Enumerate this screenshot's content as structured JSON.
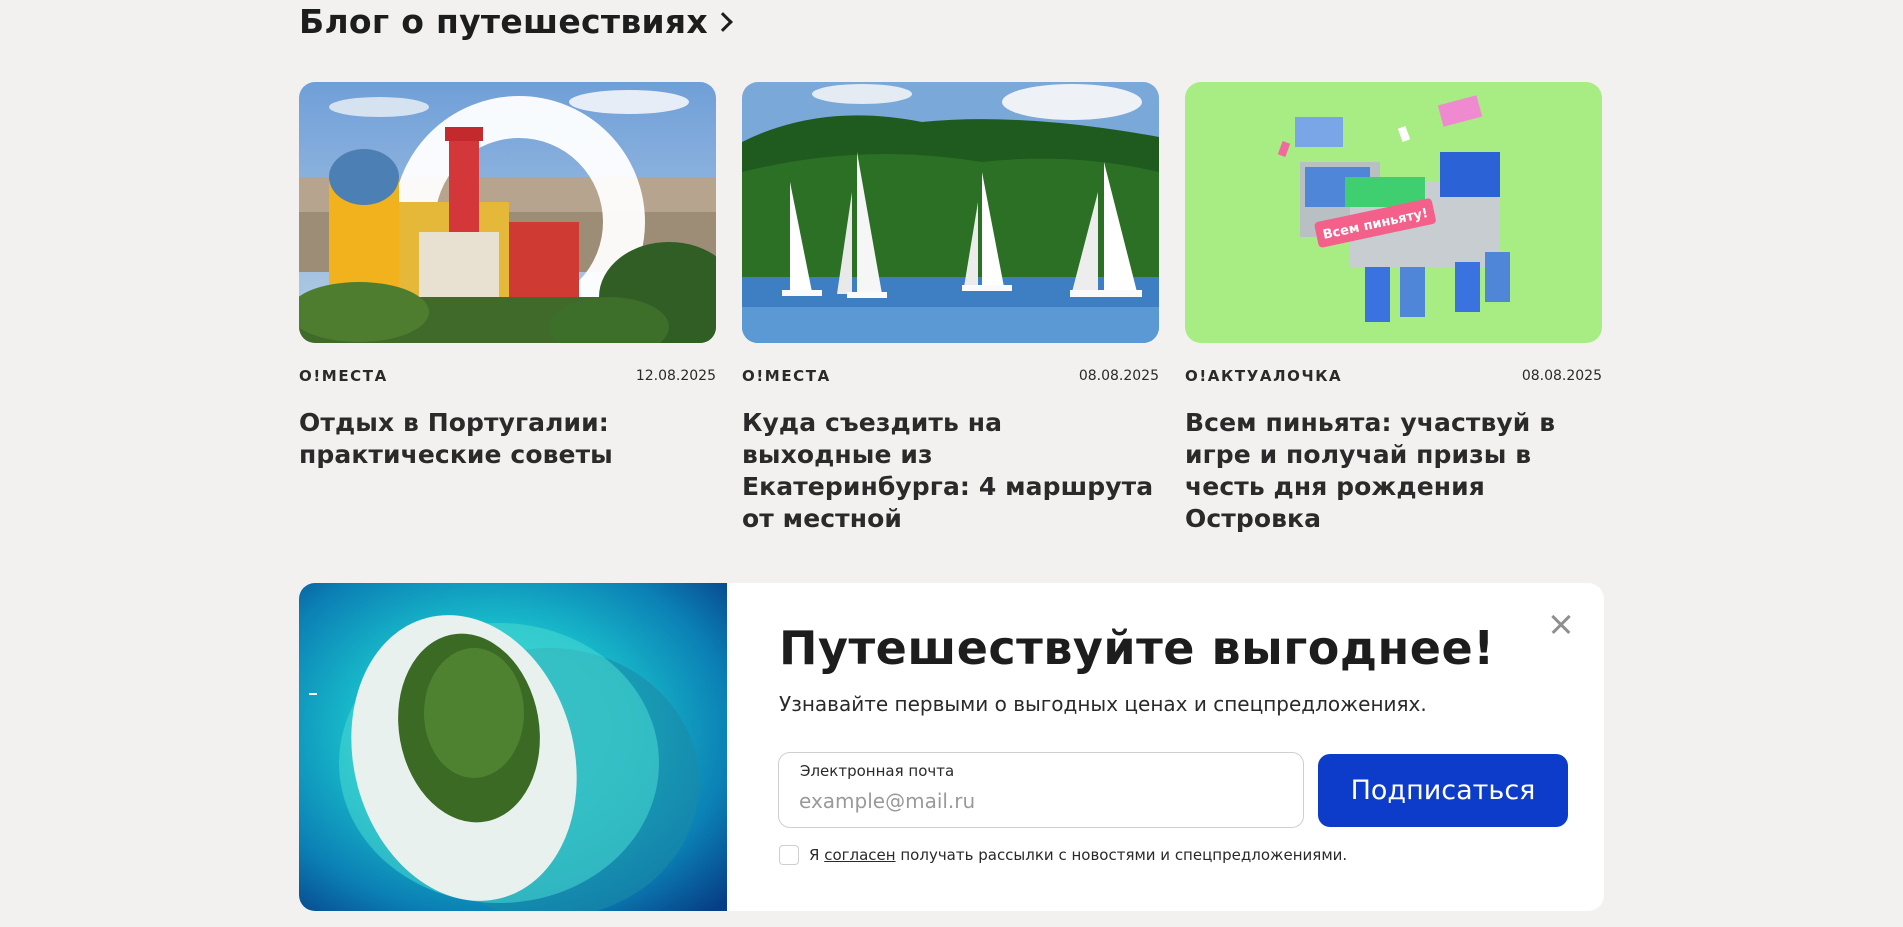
{
  "blog": {
    "title": "Блог о путешествиях",
    "cards": [
      {
        "category": "O!МЕСТА",
        "date": "12.08.2025",
        "title": "Отдых в Португалии: практические советы",
        "image": "pena-palace-portugal"
      },
      {
        "category": "O!МЕСТА",
        "date": "08.08.2025",
        "title": "Куда съездить на выходные из Екатеринбурга: 4 маршрута от местной",
        "image": "sailboats-on-lake"
      },
      {
        "category": "O!АКТУАЛОЧКА",
        "date": "08.08.2025",
        "title": "Всем пиньята: участвуй в игре и получай призы в честь дня рождения Островка",
        "image": "pinata-on-green"
      }
    ]
  },
  "promo": {
    "title": "Путешествуйте выгоднее!",
    "subtitle": "Узнавайте первыми о выгодных ценах и спецпредложениях.",
    "email_label": "Электронная почта",
    "email_placeholder": "example@mail.ru",
    "email_value": "",
    "subscribe_label": "Подписаться",
    "consent_prefix": "Я",
    "consent_link": "согласен",
    "consent_suffix": "получать рассылки с новостями и спецпредложениями.",
    "image": "tropical-island-aerial",
    "pinata_sign": "Всем пиньяту!"
  },
  "colors": {
    "background": "#f2f1ef",
    "accent": "#0c3cc9",
    "pinata_bg": "#a8ec84"
  }
}
